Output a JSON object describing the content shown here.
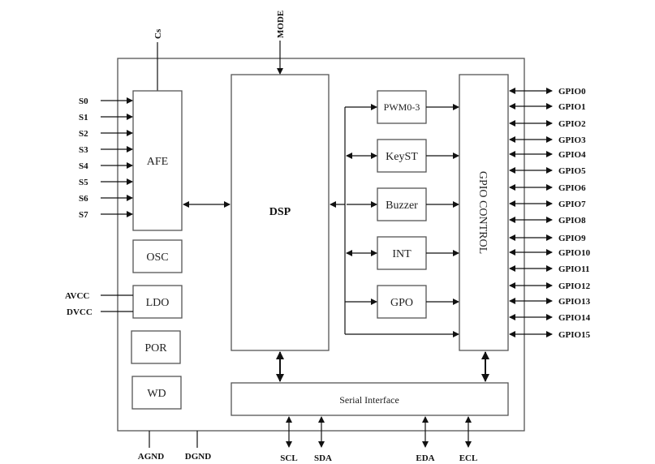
{
  "diagram": {
    "type": "block-diagram",
    "blocks": {
      "afe": "AFE",
      "dsp": "DSP",
      "osc": "OSC",
      "ldo": "LDO",
      "por": "POR",
      "wd": "WD",
      "pwm": "PWM0-3",
      "keyst": "KeyST",
      "buzzer": "Buzzer",
      "int": "INT",
      "gpo": "GPO",
      "gpio_control": "GPIO CONTROL",
      "serial": "Serial Interface"
    },
    "top_pins": {
      "cs": "Cs",
      "mode": "MODE"
    },
    "sensor_inputs": [
      "S0",
      "S1",
      "S2",
      "S3",
      "S4",
      "S5",
      "S6",
      "S7"
    ],
    "power_pins": [
      "AVCC",
      "DVCC"
    ],
    "ground_pins": [
      "AGND",
      "DGND"
    ],
    "serial_pins": [
      "SCL",
      "SDA",
      "EDA",
      "ECL"
    ],
    "gpio_pins": [
      "GPIO0",
      "GPIO1",
      "GPIO2",
      "GPIO3",
      "GPIO4",
      "GPIO5",
      "GPIO6",
      "GPIO7",
      "GPIO8",
      "GPIO9",
      "GPIO10",
      "GPIO11",
      "GPIO12",
      "GPIO13",
      "GPIO14",
      "GPIO15"
    ]
  }
}
